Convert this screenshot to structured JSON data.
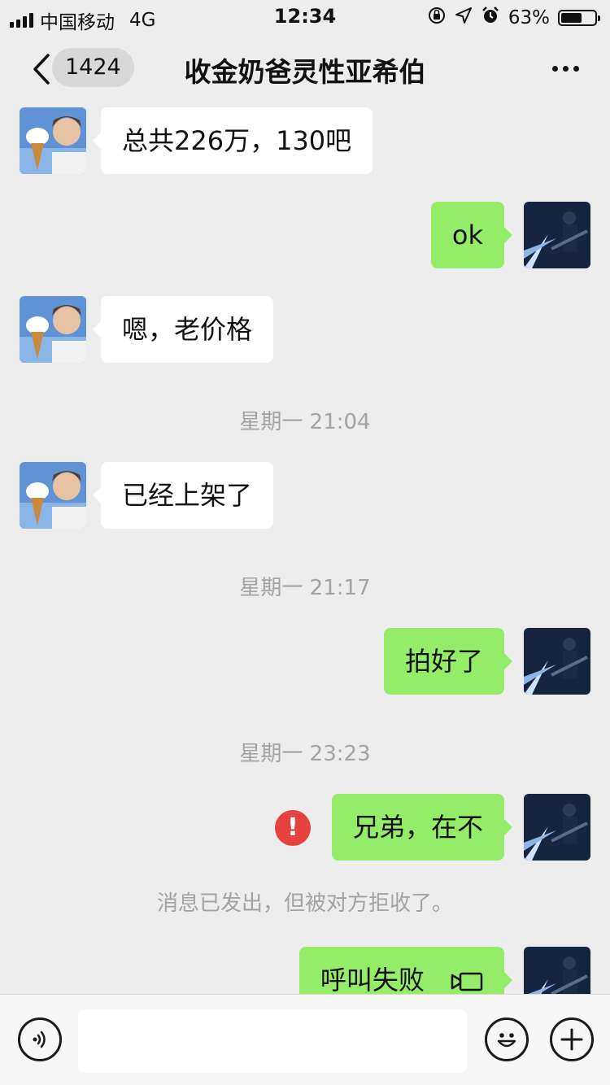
{
  "status_bar": {
    "carrier": "中国移动",
    "network": "4G",
    "time": "12:34",
    "battery_percent": "63%",
    "battery_level": 0.63
  },
  "nav": {
    "unread_count": "1424",
    "title": "收金奶爸灵性亚希伯"
  },
  "messages": {
    "m1": "总共226万，130吧",
    "m2": "ok",
    "m3": "嗯，老价格",
    "ts1": "星期一 21:04",
    "m4": "已经上架了",
    "ts2": "星期一 21:17",
    "m5": "拍好了",
    "ts3": "星期一 23:23",
    "m6": "兄弟，在不",
    "error_mark": "!",
    "notice": "消息已发出，但被对方拒收了。",
    "m7": "呼叫失败"
  },
  "colors": {
    "background": "#ededed",
    "incoming_bubble": "#ffffff",
    "outgoing_bubble": "#95ec69",
    "error": "#e64340",
    "meta_text": "#a3a3a3"
  },
  "icons": {
    "back": "chevron-left-icon",
    "more": "more-dots-icon",
    "voice": "voice-icon",
    "emoji": "emoji-icon",
    "add": "plus-icon",
    "call": "video-call-icon"
  }
}
